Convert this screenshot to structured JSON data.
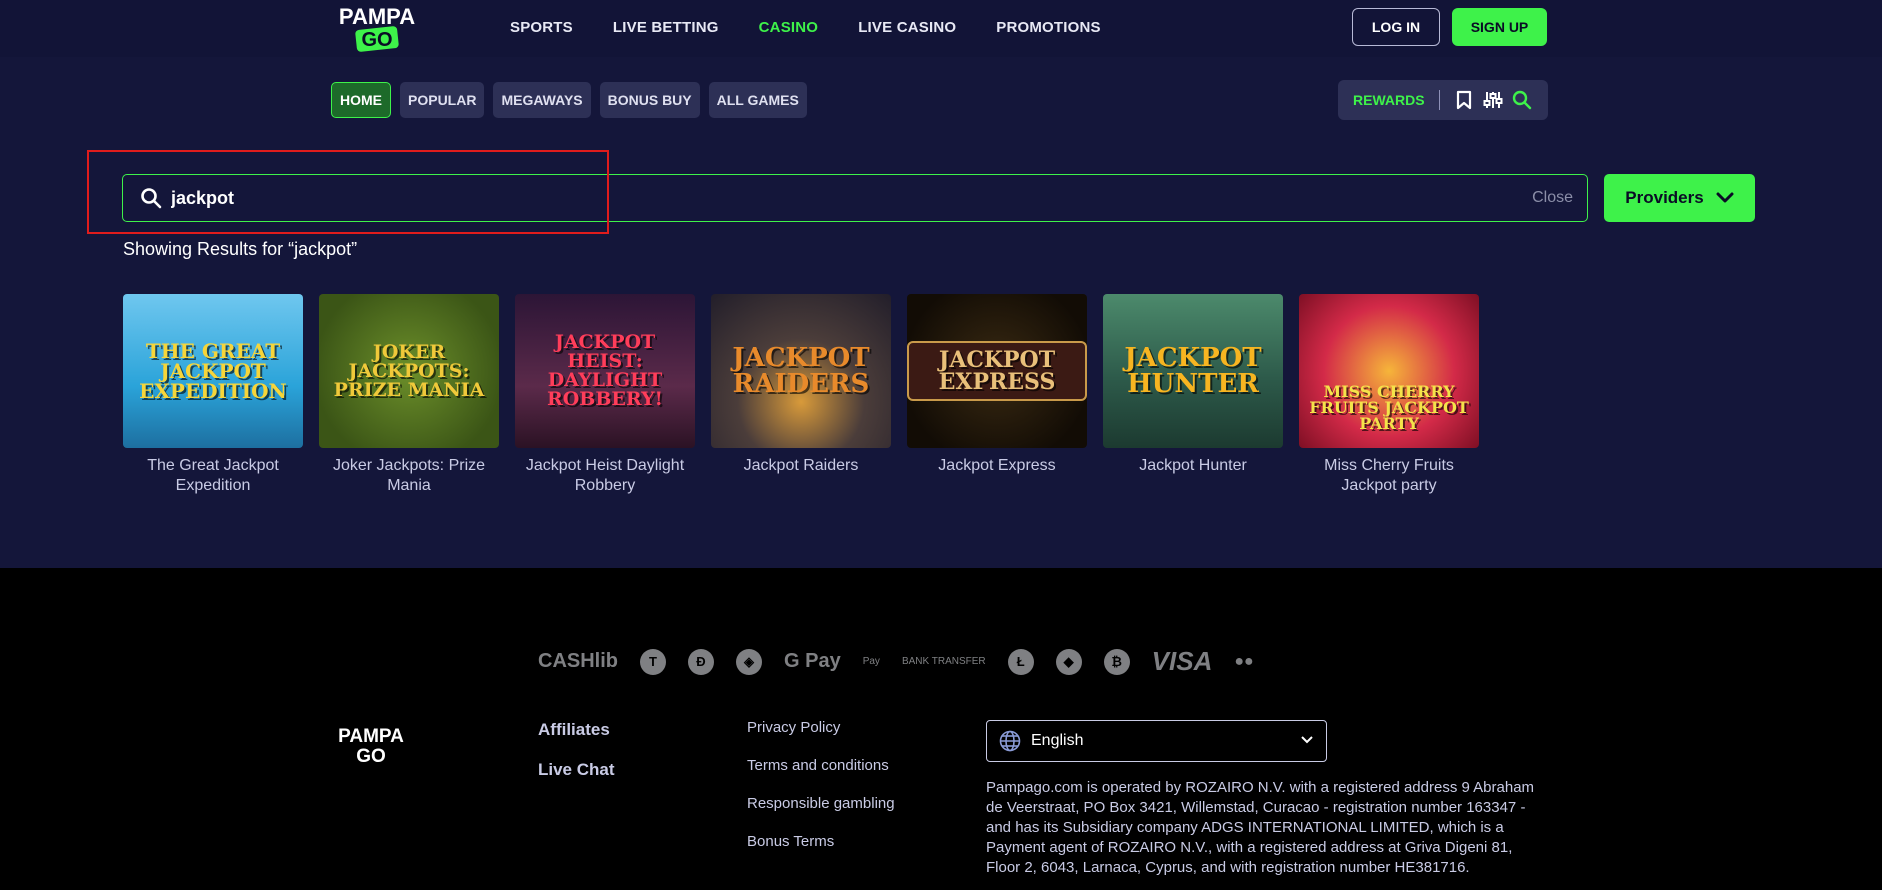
{
  "header": {
    "logo_text_top": "PAMPA",
    "logo_text_bottom": "GO",
    "nav": [
      {
        "label": "SPORTS",
        "active": false
      },
      {
        "label": "LIVE BETTING",
        "active": false
      },
      {
        "label": "CASINO",
        "active": true
      },
      {
        "label": "LIVE CASINO",
        "active": false
      },
      {
        "label": "PROMOTIONS",
        "active": false
      }
    ],
    "login_label": "LOG IN",
    "signup_label": "SIGN UP"
  },
  "categories": [
    {
      "label": "HOME",
      "active": true
    },
    {
      "label": "POPULAR",
      "active": false
    },
    {
      "label": "MEGAWAYS",
      "active": false
    },
    {
      "label": "BONUS BUY",
      "active": false
    },
    {
      "label": "ALL GAMES",
      "active": false
    }
  ],
  "tools": {
    "rewards_label": "REWARDS",
    "icons": [
      "bookmark-icon",
      "filter-sliders-icon",
      "search-icon"
    ]
  },
  "search": {
    "value": "jackpot",
    "placeholder": "Search",
    "close_label": "Close",
    "providers_label": "Providers",
    "results_label": "Showing Results for “jackpot”"
  },
  "games": [
    {
      "title": "The Great Jackpot Expedition",
      "art": "THE GREAT JACKPOT EXPEDITION",
      "bg": "#2aa3d9",
      "fg": "#f6d53a"
    },
    {
      "title": "Joker Jackpots: Prize Mania",
      "art": "JOKER JACKPOTS: PRIZE MANIA",
      "bg": "#4a6b1e",
      "fg": "#f0c93a"
    },
    {
      "title": "Jackpot Heist Daylight Robbery",
      "art": "JACKPOT HEIST: DAYLIGHT ROBBERY!",
      "bg": "#4a1f3c",
      "fg": "#ff3d5a"
    },
    {
      "title": "Jackpot Raiders",
      "art": "JACKPOT RAIDERS",
      "bg": "#2f2a3a",
      "fg": "#e88a2b"
    },
    {
      "title": "Jackpot Express",
      "art": "JACKPOT EXPRESS",
      "bg": "#1c1409",
      "fg": "#e9c07a"
    },
    {
      "title": "Jackpot Hunter",
      "art": "JACKPOT HUNTER",
      "bg": "#2d5a4a",
      "fg": "#f7b521"
    },
    {
      "title": "Miss Cherry Fruits Jackpot party",
      "art": "MISS CHERRY FRUITS JACKPOT PARTY",
      "bg": "#c21a3a",
      "fg": "#f4e34a"
    }
  ],
  "footer": {
    "payments": [
      "CASHlib",
      "T",
      "Đ",
      "◈",
      "G Pay",
      "Pay",
      "BANK TRANSFER",
      "Ł",
      "◆",
      "₿",
      "VISA",
      "●●"
    ],
    "links_primary": [
      "Affiliates",
      "Live Chat"
    ],
    "links_secondary": [
      "Privacy Policy",
      "Terms and conditions",
      "Responsible gambling",
      "Bonus Terms"
    ],
    "language": "English",
    "legal": "Pampago.com is operated by ROZAIRO N.V. with a registered address 9 Abraham de Veerstraat, PO Box 3421, Willemstad, Curacao - registration number 163347 - and has its Subsidiary company ADGS INTERNATIONAL LIMITED, which is a Payment agent of ROZAIRO N.V., with a registered address at Griva Digeni 81, Floor 2, 6043, Larnaca, Cyprus, and with registration number HE381716."
  },
  "colors": {
    "accent": "#3ef24a",
    "header_bg": "#121437",
    "page_bg": "#14163a",
    "chip_bg": "#2d3056",
    "highlight": "#e01c1c"
  }
}
